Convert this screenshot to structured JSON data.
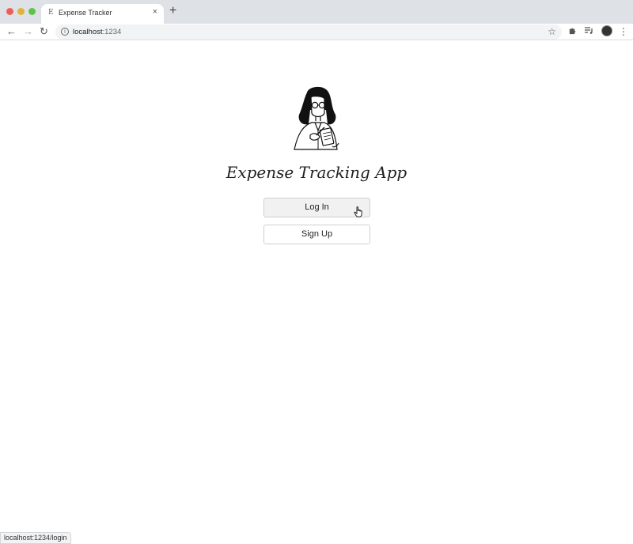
{
  "browser": {
    "tab": {
      "favicon": "E",
      "title": "Expense Tracker",
      "close": "×"
    },
    "new_tab": "+",
    "nav": {
      "back": "←",
      "forward": "→",
      "reload": "↻"
    },
    "omnibox": {
      "info": "i",
      "host": "localhost",
      "port": ":1234",
      "star": "☆"
    },
    "icons": {
      "extensions": "puzzle-icon",
      "media": "media-icon",
      "profile": "avatar",
      "menu": "⋮"
    },
    "status_url": "localhost:1234/login"
  },
  "page": {
    "title": "Expense Tracking App",
    "buttons": {
      "login": "Log In",
      "signup": "Sign Up"
    }
  },
  "colors": {
    "tabbar": "#dee1e6",
    "traffic_red": "#ec5f57",
    "traffic_yellow": "#e0b33a",
    "traffic_green": "#5fc349"
  }
}
